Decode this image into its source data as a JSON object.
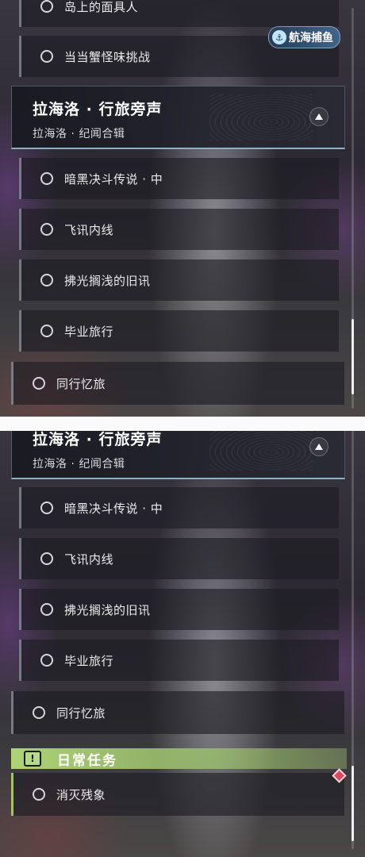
{
  "panel1": {
    "cut_top_label": "岛上的面具人",
    "badge_label": "航海捕鱼",
    "row_before_header": "当当蟹怪味挑战",
    "section": {
      "title": "拉海洛 · 行旅旁声",
      "subtitle": "拉海洛 · 纪闻合辑"
    },
    "sub_quests": [
      "暗黑决斗传说 · 中",
      "飞讯内线",
      "拂光搁浅的旧讯",
      "毕业旅行"
    ],
    "outer_quest": "同行忆旅"
  },
  "panel2": {
    "section": {
      "title": "拉海洛 · 行旅旁声",
      "subtitle": "拉海洛 · 纪闻合辑"
    },
    "sub_quests": [
      "暗黑决斗传说 · 中",
      "飞讯内线",
      "拂光搁浅的旧讯",
      "毕业旅行"
    ],
    "outer_quest": "同行忆旅",
    "daily": {
      "header": "日常任务",
      "alert_symbol": "!",
      "quest": "消灭残象"
    }
  },
  "icons": {
    "quest_marker": "ring-icon",
    "collapse": "chevron-up-icon",
    "daily": "alert-icon",
    "tracked": "diamond-marker-icon",
    "badge": "fishing-icon"
  },
  "colors": {
    "daily_accent": "#9dc56f",
    "tracked_marker": "#e0455a",
    "badge_accent": "#bfe5ff"
  }
}
